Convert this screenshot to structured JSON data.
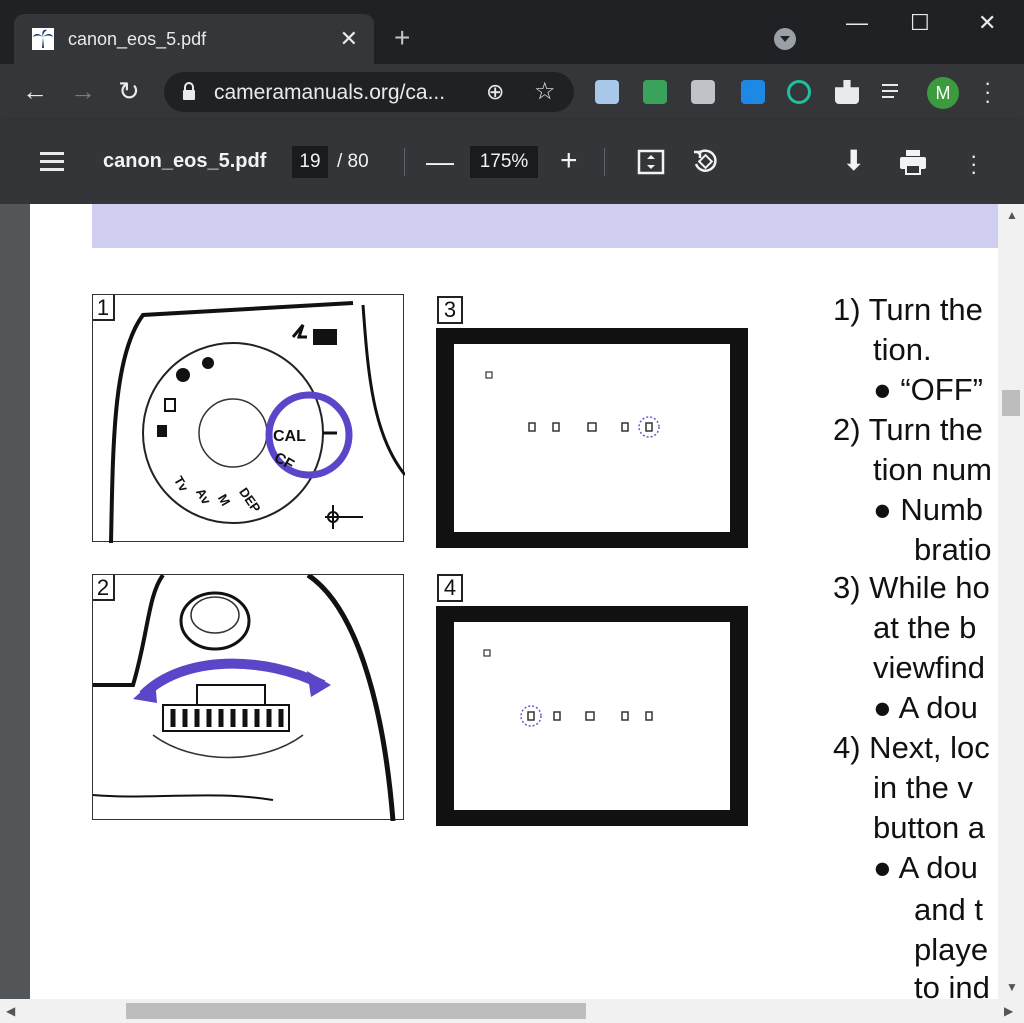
{
  "tab": {
    "title": "canon_eos_5.pdf",
    "close": "✕",
    "new_tab": "+"
  },
  "window": {
    "minimize": "—",
    "maximize": "☐",
    "close": "✕"
  },
  "toolbar": {
    "back": "←",
    "forward": "→",
    "reload": "↻",
    "url": "cameramanuals.org/ca...",
    "zoom_icon": "⊕",
    "star": "☆",
    "avatar_letter": "M",
    "menu": "⋮"
  },
  "pdf": {
    "title": "canon_eos_5.pdf",
    "page_current": "19",
    "page_total": "/ 80",
    "zoom": "175%",
    "minus": "—",
    "plus": "+",
    "fit_icon": "fit-page-icon",
    "rotate_icon": "rotate-icon",
    "download": "⬇",
    "print": "🖶",
    "more": "⋮"
  },
  "figures": {
    "f1": "1",
    "f2": "2",
    "f3": "3",
    "f4": "4",
    "dial_cal": "CAL",
    "dial_cf": "CF",
    "dial_dep": "DEP",
    "dial_m": "M",
    "dial_av": "Av",
    "dial_tv": "Tv"
  },
  "manual": {
    "l1": "1) Turn the",
    "l2": "tion.",
    "l3": "●  “OFF”",
    "l4": "2) Turn the",
    "l5": "tion num",
    "l6": "●  Numb",
    "l7": "bratio",
    "l8": "3) While ho",
    "l9": "at the b",
    "l10": "viewfind",
    "l11": "●  A dou",
    "l12": "4) Next, loc",
    "l13": "in the v",
    "l14": "button a",
    "l15": "●  A dou",
    "l16": "and t",
    "l17": "playe",
    "l18": "to ind"
  },
  "colors": {
    "accent": "#6a5acd",
    "band": "#cfcdf0"
  }
}
